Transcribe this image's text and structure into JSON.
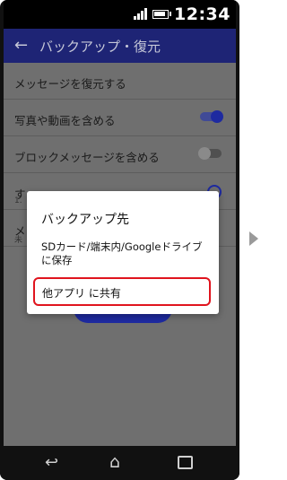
{
  "status_bar": {
    "time": "12:34"
  },
  "app_bar": {
    "title": "バックアップ・復元",
    "back_icon": "←"
  },
  "settings": [
    {
      "label": "メッセージを復元する",
      "sub": "",
      "control": "none"
    },
    {
      "label": "写真や動画を含める",
      "sub": "",
      "control": "toggle-on"
    },
    {
      "label": "ブロックメッセージを含める",
      "sub": "",
      "control": "toggle-off"
    },
    {
      "label": "す",
      "sub": "1.",
      "control": "radio"
    },
    {
      "label": "メ",
      "sub": "未",
      "control": "none"
    }
  ],
  "dialog": {
    "title": "バックアップ先",
    "option_1": "SDカード/端末内/Googleドライブに保存",
    "option_2": "他アプリ に共有"
  },
  "navbar": {
    "back_icon": "↩",
    "home_icon": "⌂"
  },
  "colors": {
    "appbar": "#1e2475",
    "accent": "#1e2aa0",
    "highlight": "#e0141e"
  }
}
